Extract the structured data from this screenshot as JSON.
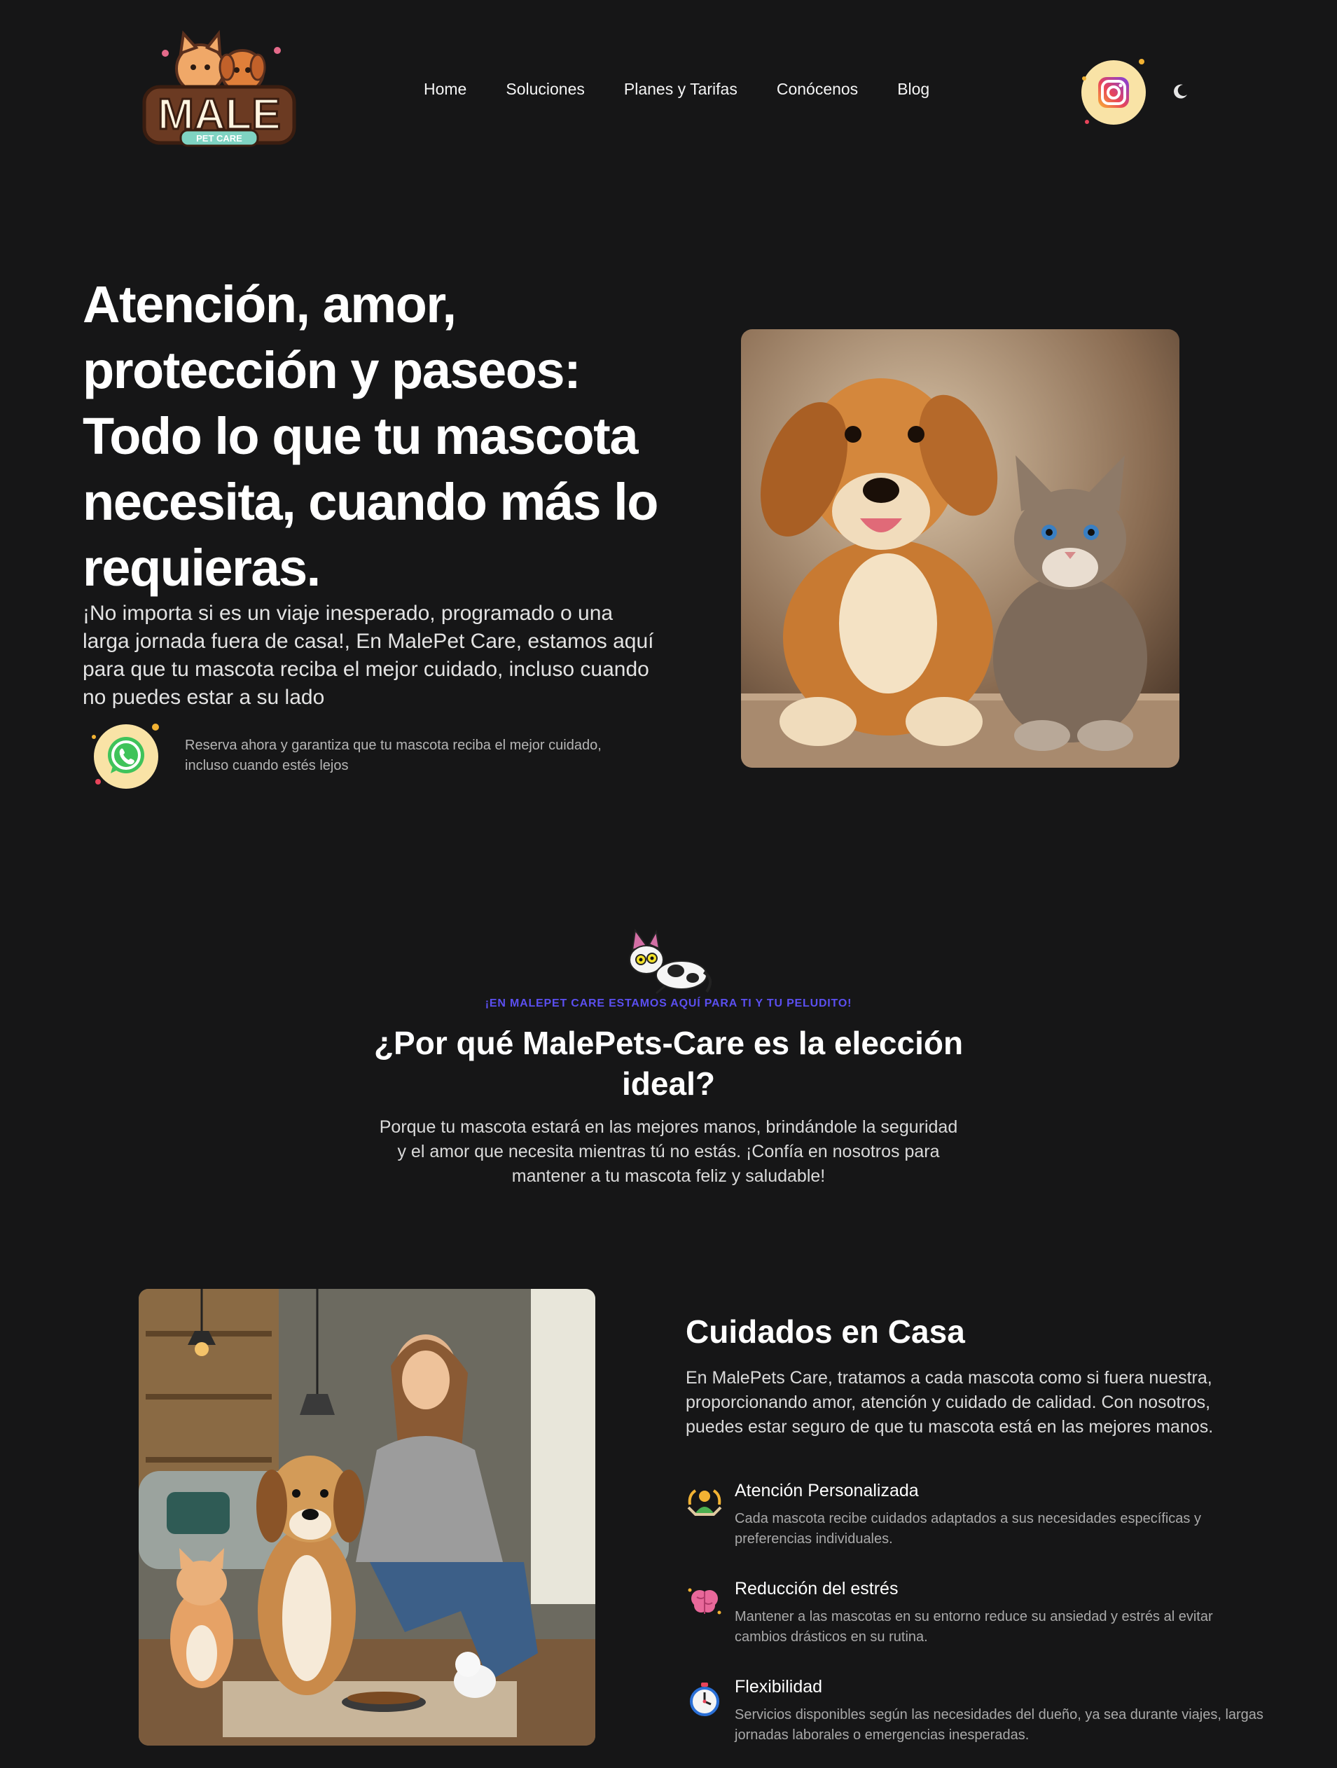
{
  "header": {
    "logo": {
      "title": "MALE",
      "subtitle": "PET CARE"
    },
    "nav": [
      "Home",
      "Soluciones",
      "Planes y Tarifas",
      "Conócenos",
      "Blog"
    ],
    "social_icon": "instagram-icon",
    "theme_icon": "moon-icon"
  },
  "hero": {
    "title": "Atención, amor, protección y paseos: Todo lo que tu mascota necesita, cuando más lo requieras.",
    "description": "¡No importa si es un viaje inesperado, programado o una larga jornada fuera de casa!, En MalePet Care, estamos aquí para que tu mascota reciba el mejor cuidado, incluso cuando no puedes estar a su lado",
    "cta_icon": "whatsapp-icon",
    "cta_note": "Reserva ahora y garantiza que tu mascota reciba el mejor cuidado, incluso cuando estés lejos",
    "image": "dog-and-cat-photo"
  },
  "why": {
    "eyebrow": "¡EN MALEPET CARE ESTAMOS AQUÍ PARA TI Y TU PELUDITO!",
    "title": "¿Por qué MalePets-Care es la elección ideal?",
    "description": "Porque tu mascota estará en las mejores manos, brindándole la seguridad y el amor que necesita mientras tú no estás. ¡Confía en nosotros para mantener a tu mascota feliz y saludable!"
  },
  "care": {
    "image": "woman-feeding-pets-photo",
    "title": "Cuidados en Casa",
    "description": "En MalePets Care, tratamos a cada mascota como si fuera nuestra, proporcionando amor, atención y cuidado de calidad. Con nosotros, puedes estar seguro de que tu mascota está en las mejores manos.",
    "features": [
      {
        "icon": "care-person-icon",
        "title": "Atención Personalizada",
        "text": "Cada mascota recibe cuidados adaptados a sus necesidades específicas y preferencias individuales."
      },
      {
        "icon": "brain-icon",
        "title": "Reducción del estrés",
        "text": "Mantener a las mascotas en su entorno reduce su ansiedad y estrés al evitar cambios drásticos en su rutina."
      },
      {
        "icon": "stopwatch-icon",
        "title": "Flexibilidad",
        "text": "Servicios disponibles según las necesidades del dueño, ya sea durante viajes, largas jornadas laborales o emergencias inesperadas."
      }
    ]
  },
  "colors": {
    "background": "#161617",
    "accent": "#5b4ff0",
    "badge": "#f9e3a6"
  }
}
